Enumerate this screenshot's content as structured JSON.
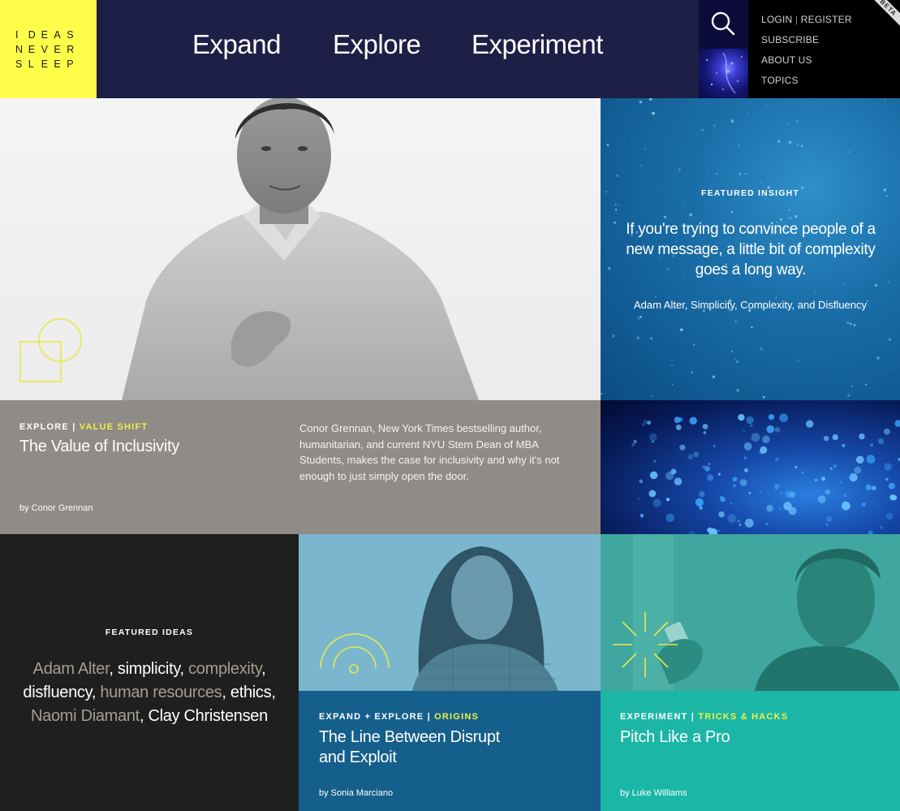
{
  "logo": {
    "letters": [
      "I",
      "D",
      "E",
      "A",
      "S",
      "N",
      "E",
      "V",
      "E",
      "R",
      "S",
      "L",
      "E",
      "E",
      "P"
    ]
  },
  "nav": {
    "items": [
      "Expand",
      "Explore",
      "Experiment"
    ]
  },
  "utility": {
    "login": "LOGIN",
    "register": "REGISTER",
    "separator": "|",
    "subscribe": "SUBSCRIBE",
    "about": "ABOUT US",
    "topics": "TOPICS",
    "beta": "BETA"
  },
  "hero": {
    "category": "EXPLORE",
    "separator": "|",
    "subcategory": "VALUE SHIFT",
    "title": "The Value of Inclusivity",
    "description": "Conor Grennan, New York Times bestselling author, humanitarian, and current NYU Stern Dean of MBA Students, makes the case for inclusivity and why it's not enough to just simply open the door.",
    "byline": "by Conor Grennan"
  },
  "insight": {
    "kicker": "FEATURED INSIGHT",
    "quote": "If you're trying to convince people of a new message, a little bit of complexity goes a long way.",
    "attribution": "Adam Alter, Simplicity, Complexity, and Disfluency"
  },
  "ideas": {
    "kicker": "FEATURED IDEAS",
    "tags": [
      {
        "text": "Adam Alter",
        "tone": "g"
      },
      {
        "text": ", ",
        "tone": "w"
      },
      {
        "text": "simplicity",
        "tone": "w"
      },
      {
        "text": ", ",
        "tone": "w"
      },
      {
        "text": "complexity",
        "tone": "g"
      },
      {
        "text": ", ",
        "tone": "w"
      },
      {
        "text": "disfluency",
        "tone": "w"
      },
      {
        "text": ", ",
        "tone": "w"
      },
      {
        "text": "human resources",
        "tone": "g"
      },
      {
        "text": ", ",
        "tone": "w"
      },
      {
        "text": "ethics",
        "tone": "w"
      },
      {
        "text": ", ",
        "tone": "w"
      },
      {
        "text": "Naomi Diamant",
        "tone": "g"
      },
      {
        "text": ", ",
        "tone": "w"
      },
      {
        "text": "Clay Christensen",
        "tone": "w"
      }
    ]
  },
  "card2": {
    "category": "EXPAND + EXPLORE",
    "separator": "|",
    "subcategory": "ORIGINS",
    "title_line1": "The Line Between Disrupt",
    "title_line2": "and Exploit",
    "byline": "by Sonia Marciano"
  },
  "card3": {
    "category": "EXPERIMENT",
    "separator": "|",
    "subcategory": "TRICKS & HACKS",
    "title": "Pitch Like a Pro",
    "byline": "by Luke Williams"
  },
  "colors": {
    "accent_yellow": "#f0f04a",
    "nav_bg": "#1e1f46",
    "logo_bg": "#fdfd4a",
    "card2_bg": "#155f8c",
    "card3_bg": "#1bb6a6",
    "hero_caption_bg": "#8f8b86"
  }
}
